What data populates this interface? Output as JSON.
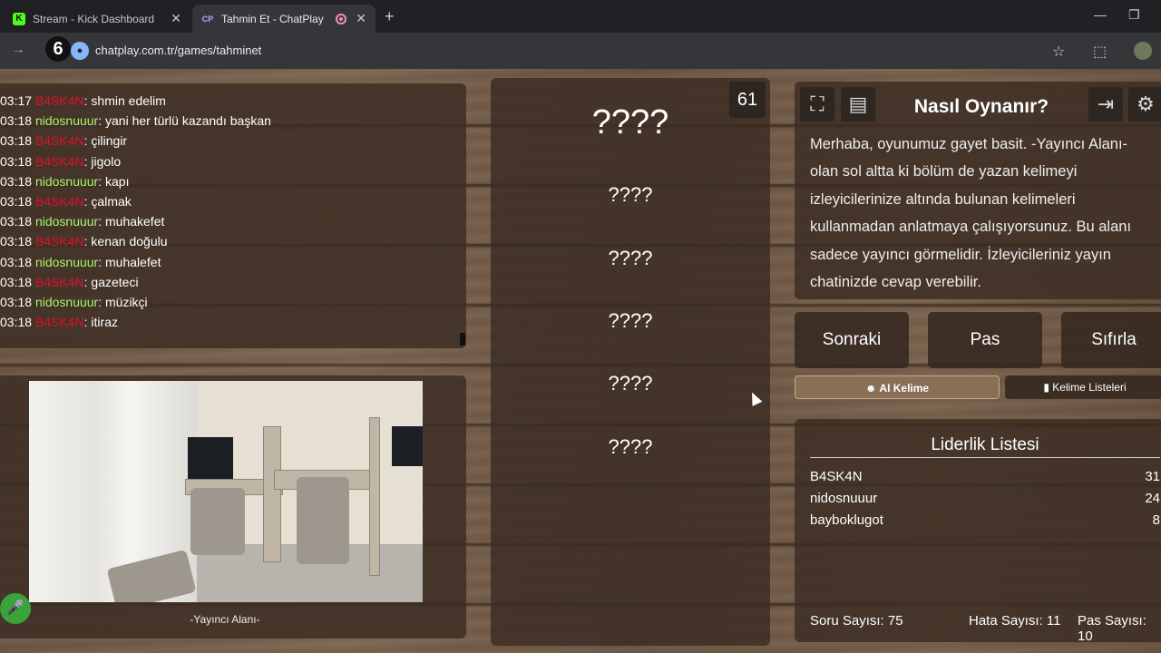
{
  "browser": {
    "tabs": [
      {
        "title": "Stream - Kick Dashboard",
        "favicon": "K"
      },
      {
        "title": "Tahmin Et - ChatPlay",
        "favicon": "CP"
      }
    ],
    "url": "chatplay.com.tr/games/tahminet",
    "overlay_badge": "6"
  },
  "chat": {
    "lines": [
      {
        "time": "03:17",
        "user": "B4SK4N",
        "msg": ": shmin edelim",
        "color": "red"
      },
      {
        "time": "03:18",
        "user": "nidosnuuur",
        "msg": ": yani her türlü kazandı başkan",
        "color": "green"
      },
      {
        "time": "03:18",
        "user": "B4SK4N",
        "msg": ": çilingir",
        "color": "red"
      },
      {
        "time": "03:18",
        "user": "B4SK4N",
        "msg": ": jigolo",
        "color": "red"
      },
      {
        "time": "03:18",
        "user": "nidosnuuur",
        "msg": ": kapı",
        "color": "green"
      },
      {
        "time": "03:18",
        "user": "B4SK4N",
        "msg": ": çalmak",
        "color": "red"
      },
      {
        "time": "03:18",
        "user": "nidosnuuur",
        "msg": ": muhakefet",
        "color": "green"
      },
      {
        "time": "03:18",
        "user": "B4SK4N",
        "msg": ": kenan doğulu",
        "color": "red"
      },
      {
        "time": "03:18",
        "user": "nidosnuuur",
        "msg": ": muhalefet",
        "color": "green"
      },
      {
        "time": "03:18",
        "user": "B4SK4N",
        "msg": ": gazeteci",
        "color": "red"
      },
      {
        "time": "03:18",
        "user": "nidosnuuur",
        "msg": ": müzikçi",
        "color": "green"
      },
      {
        "time": "03:18",
        "user": "B4SK4N",
        "msg": ": itiraz",
        "color": "red"
      }
    ]
  },
  "camera": {
    "label": "-Yayıncı Alanı-"
  },
  "words": {
    "timer": "61",
    "main": "????",
    "forbidden": [
      "????",
      "????",
      "????",
      "????",
      "????"
    ]
  },
  "howto": {
    "title": "Nasıl Oynanır?",
    "text": "Merhaba, oyunumuz gayet basit. -Yayıncı Alanı- olan sol altta ki bölüm de yazan kelimeyi izleyicilerinize altında bulunan kelimeleri kullanmadan anlatmaya çalışıyorsunuz. Bu alanı sadece yayıncı görmelidir. İzleyicileriniz yayın chatinizde cevap verebilir."
  },
  "controls": {
    "next": "Sonraki",
    "pass": "Pas",
    "reset": "Sıfırla",
    "ai_word": "AI Kelime",
    "word_lists": "Kelime Listeleri"
  },
  "leaderboard": {
    "title": "Liderlik Listesi",
    "rows": [
      {
        "name": "B4SK4N",
        "score": "31"
      },
      {
        "name": "nidosnuuur",
        "score": "24"
      },
      {
        "name": "bayboklugot",
        "score": "8"
      }
    ],
    "questions": "Soru Sayısı: 75",
    "errors": "Hata Sayısı: 11",
    "passes": "Pas Sayısı: 10"
  },
  "colors": {
    "user_red": "#e0102d",
    "user_green": "#a9f26b",
    "kick_green": "#53fc18"
  }
}
